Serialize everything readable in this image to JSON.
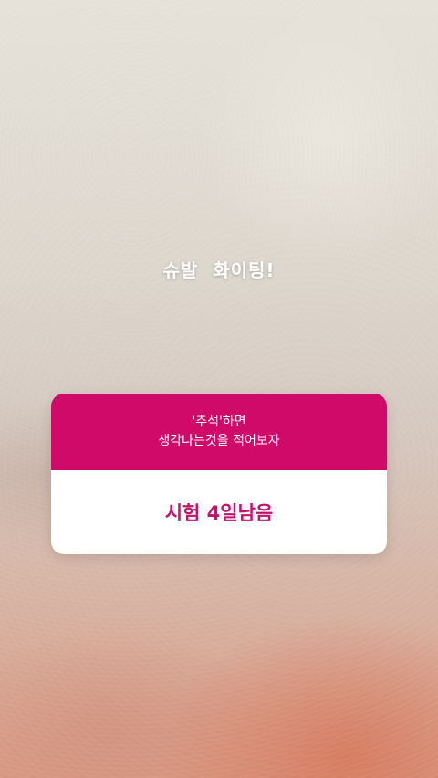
{
  "story": {
    "caption": "슈발  화이팅!"
  },
  "question_sticker": {
    "prompt_line1": "'추석'하면",
    "prompt_line2": "생각나는것을 적어보자",
    "answer": "시험 4일남음",
    "header_color": "#cf0a69",
    "answer_color": "#c4136d"
  }
}
